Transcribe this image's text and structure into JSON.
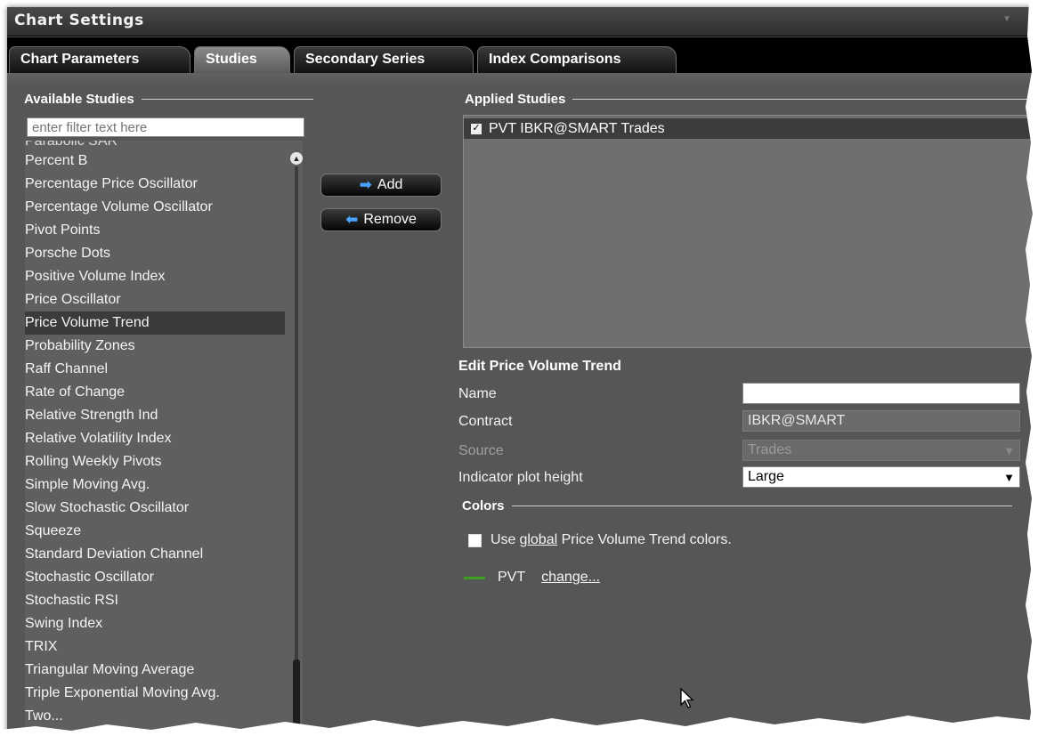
{
  "window": {
    "title": "Chart Settings"
  },
  "tabs": [
    {
      "label": "Chart Parameters",
      "active": false
    },
    {
      "label": "Studies",
      "active": true
    },
    {
      "label": "Secondary Series",
      "active": false
    },
    {
      "label": "Index Comparisons",
      "active": false
    }
  ],
  "available": {
    "header": "Available Studies",
    "filter_placeholder": "enter filter text here",
    "items": [
      "Parabolic SAR",
      "Percent B",
      "Percentage Price Oscillator",
      "Percentage Volume Oscillator",
      "Pivot Points",
      "Porsche Dots",
      "Positive Volume Index",
      "Price Oscillator",
      "Price Volume Trend",
      "Probability Zones",
      "Raff Channel",
      "Rate of Change",
      "Relative Strength Ind",
      "Relative Volatility Index",
      "Rolling Weekly Pivots",
      "Simple Moving Avg.",
      "Slow Stochastic Oscillator",
      "Squeeze",
      "Standard Deviation Channel",
      "Stochastic Oscillator",
      "Stochastic RSI",
      "Swing Index",
      "TRIX",
      "Triangular Moving Average",
      "Triple Exponential Moving Avg.",
      "Two..."
    ],
    "selected": "Price Volume Trend"
  },
  "buttons": {
    "add": "Add",
    "remove": "Remove"
  },
  "applied": {
    "header": "Applied Studies",
    "items": [
      {
        "label": "PVT IBKR@SMART Trades",
        "checked": true
      }
    ]
  },
  "edit": {
    "title": "Edit Price Volume Trend",
    "name_label": "Name",
    "name_value": "",
    "contract_label": "Contract",
    "contract_value": "IBKR@SMART",
    "source_label": "Source",
    "source_value": "Trades",
    "height_label": "Indicator plot height",
    "height_value": "Large"
  },
  "colors": {
    "header": "Colors",
    "use_prefix": "Use ",
    "use_link": "global",
    "use_suffix": " Price Volume Trend colors.",
    "series_name": "PVT",
    "change_link": "change...",
    "series_color": "#3f9f1f"
  },
  "icons": {
    "add": "arrow-right-icon",
    "remove": "arrow-left-icon",
    "scroll": "scroll-up-icon",
    "cursor": "mouse-pointer-icon"
  }
}
